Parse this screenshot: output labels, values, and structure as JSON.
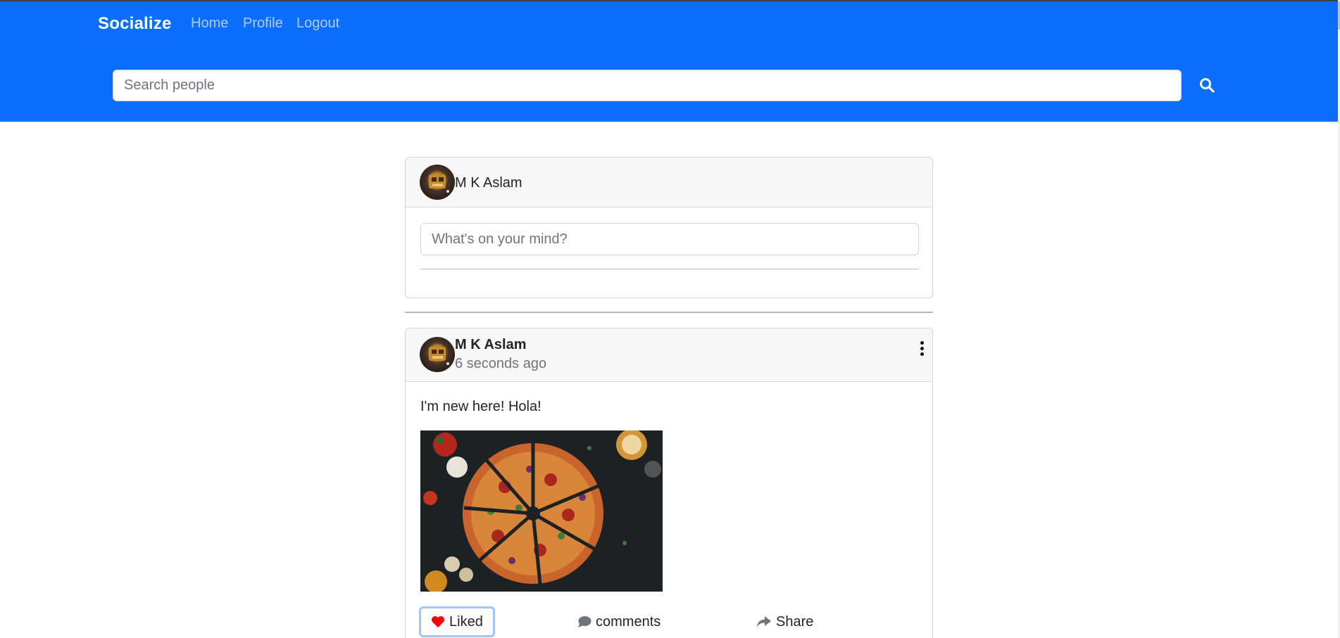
{
  "navbar": {
    "brand": "Socialize",
    "links": [
      "Home",
      "Profile",
      "Logout"
    ]
  },
  "search": {
    "placeholder": "Search people",
    "button_icon": "search-icon"
  },
  "composer": {
    "user_name": "M K Aslam",
    "placeholder": "What's on your mind?"
  },
  "post": {
    "author": "M K Aslam",
    "time": "6 seconds ago",
    "text": "I'm new here! Hola!",
    "image_icon": "pizza-image",
    "menu_icon": "kebab-menu-icon",
    "actions": {
      "like_label": "Liked",
      "comments_label": "comments",
      "share_label": "Share"
    }
  },
  "colors": {
    "header_bg": "#0d6efd",
    "like_heart": "#ff0000"
  }
}
